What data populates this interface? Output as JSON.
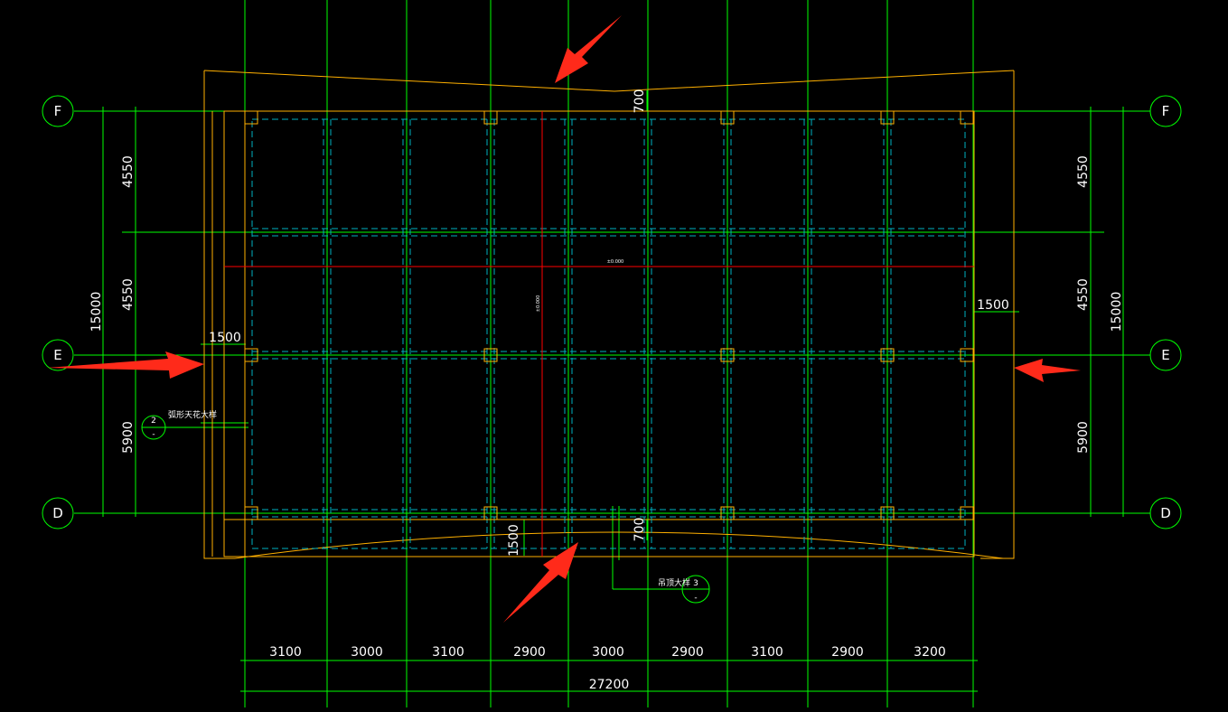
{
  "drawing": {
    "axes_horizontal": [
      "F",
      "E",
      "D"
    ],
    "dims_left": [
      "4550",
      "4550",
      "5900"
    ],
    "dims_left_total": "15000",
    "dims_right": [
      "4550",
      "4550",
      "5900"
    ],
    "dims_right_total": "15000",
    "dims_bottom": [
      "3100",
      "3000",
      "3100",
      "2900",
      "3000",
      "2900",
      "3100",
      "2900",
      "3200"
    ],
    "dims_bottom_total": "27200",
    "offset_left": "1500",
    "offset_right": "1500",
    "offset_bottom_left": "1500",
    "top_curve": "700",
    "bottom_curve": "700",
    "detail_left": {
      "label": "弧形天花大样",
      "num": "2",
      "sub": "-"
    },
    "detail_bottom": {
      "label": "吊顶大样",
      "num": "3",
      "sub": "-"
    },
    "center_label_h": "±0.000",
    "center_label_v": "±0.000"
  },
  "colors": {
    "background": "#000000",
    "grid": "#00ff00",
    "outline": "#ffb000",
    "dashed": "#00b0c0",
    "centerline": "#ff0000",
    "arrow": "#ff2a1a",
    "text": "#ffffff"
  }
}
